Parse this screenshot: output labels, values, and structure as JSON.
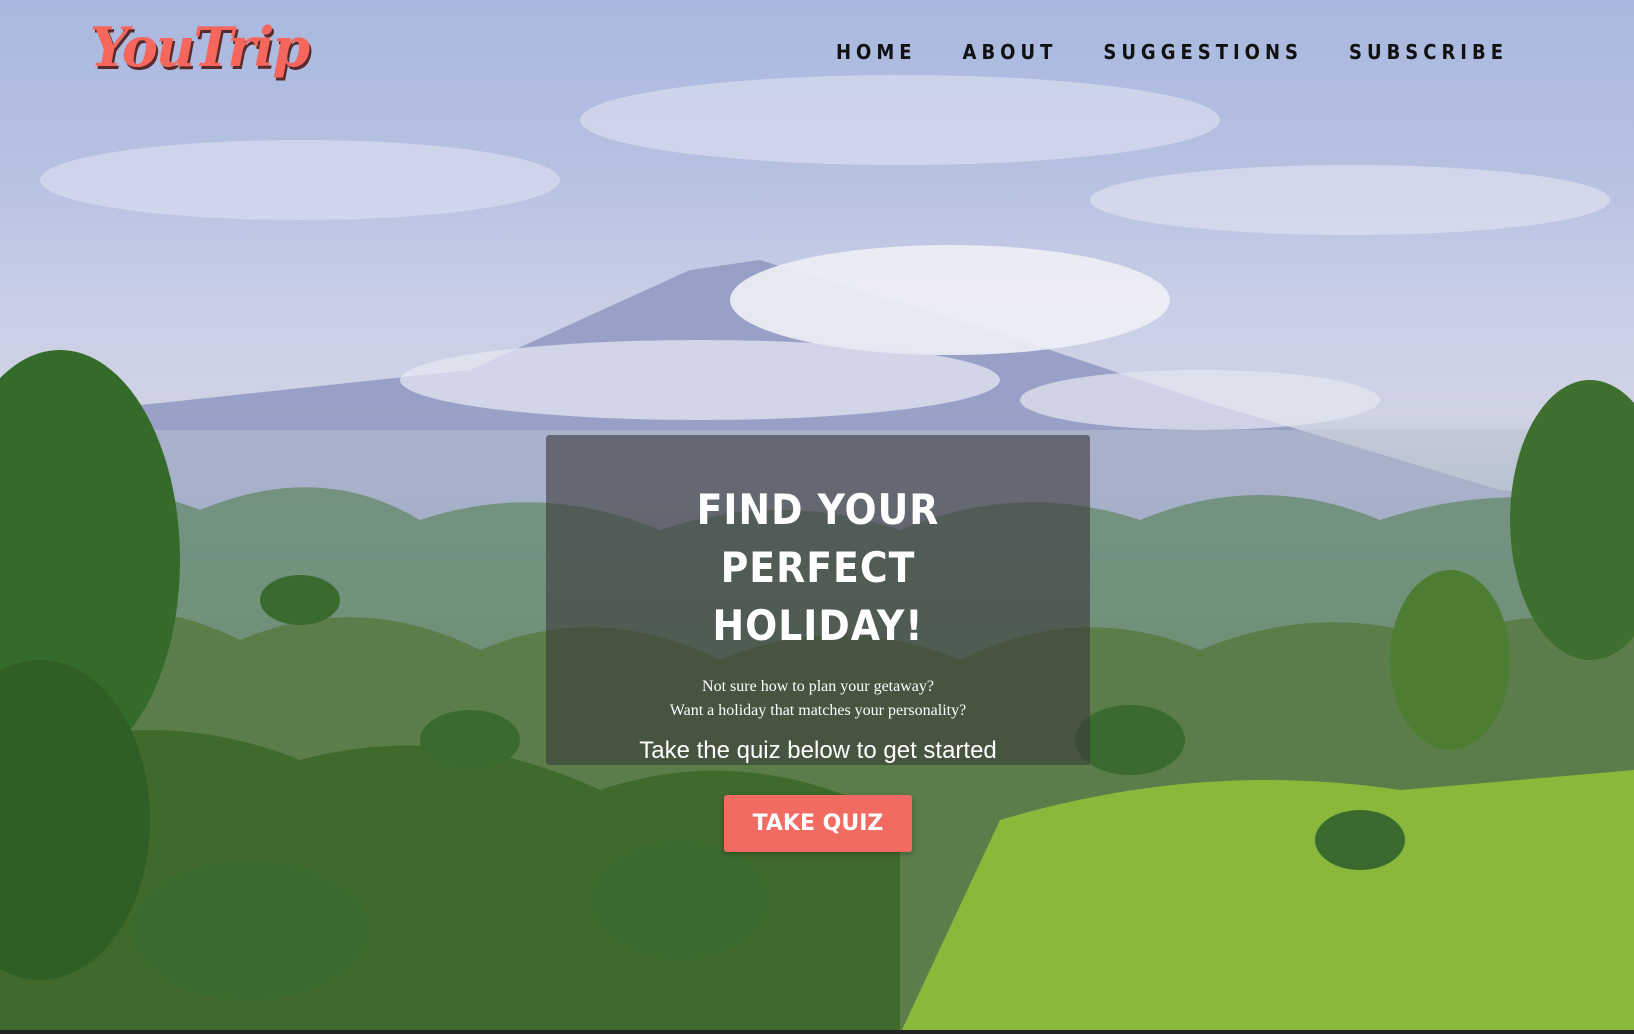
{
  "brand": {
    "logo_text": "YouTrip",
    "accent_color": "#f26b62"
  },
  "nav": {
    "items": [
      {
        "label": "HOME"
      },
      {
        "label": "ABOUT"
      },
      {
        "label": "SUGGESTIONS"
      },
      {
        "label": "SUBSCRIBE"
      }
    ]
  },
  "hero": {
    "title": "FIND YOUR PERFECT HOLIDAY!",
    "subtitle_line1": "Not sure how to plan your getaway?",
    "subtitle_line2": "Want a holiday that matches your personality?",
    "cta_text": "Take the quiz below to get started",
    "button_label": "TAKE QUIZ",
    "background_image": "mountain-jungle-landscape"
  }
}
